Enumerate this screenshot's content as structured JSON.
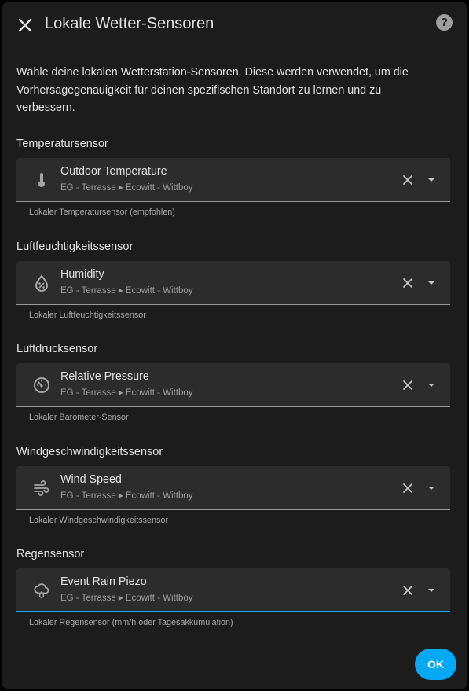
{
  "dialog": {
    "title": "Lokale Wetter-Sensoren",
    "help_label": "?",
    "description": "Wähle deine lokalen Wetterstation-Sensoren. Diese werden verwendet, um die Vorhersagegenauigkeit für deinen spezifischen Standort zu lernen und zu verbessern.",
    "ok_label": "OK"
  },
  "accent_color": "#03a9f4",
  "sections": [
    {
      "label": "Temperatursensor",
      "icon": "thermometer-icon",
      "entity_name": "Outdoor Temperature",
      "area": "EG - Terrasse",
      "device": "Ecowitt - Wittboy",
      "helper": "Lokaler Temperatursensor (empfohlen)"
    },
    {
      "label": "Luftfeuchtigkeitssensor",
      "icon": "water-percent-icon",
      "entity_name": "Humidity",
      "area": "EG - Terrasse",
      "device": "Ecowitt - Wittboy",
      "helper": "Lokaler Luftfeuchtigkeitssensor"
    },
    {
      "label": "Luftdrucksensor",
      "icon": "gauge-icon",
      "entity_name": "Relative Pressure",
      "area": "EG - Terrasse",
      "device": "Ecowitt - Wittboy",
      "helper": "Lokaler Barometer-Sensor"
    },
    {
      "label": "Windgeschwindigkeitssensor",
      "icon": "weather-windy-icon",
      "entity_name": "Wind Speed",
      "area": "EG - Terrasse",
      "device": "Ecowitt - Wittboy",
      "helper": "Lokaler Windgeschwindigkeitssensor"
    },
    {
      "label": "Regensensor",
      "icon": "weather-rainy-icon",
      "entity_name": "Event Rain Piezo",
      "area": "EG - Terrasse",
      "device": "Ecowitt - Wittboy",
      "helper": "Lokaler Regensensor (mm/h oder Tagesakkumulation)"
    }
  ]
}
